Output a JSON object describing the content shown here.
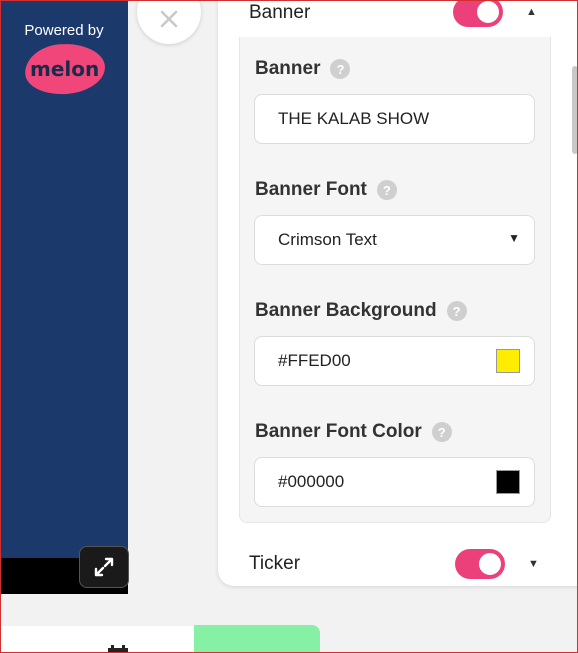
{
  "preview": {
    "powered_by": "Powered by",
    "logo_text": "melon",
    "bg_color": "#1b3a6b",
    "logo_color": "#f0467a"
  },
  "icons": {
    "close": "close-icon",
    "fullscreen": "expand-icon",
    "help": "help-icon",
    "calendar": "calendar-icon"
  },
  "banner_section": {
    "title": "Banner",
    "enabled": true,
    "expanded": true,
    "help_glyph": "?",
    "fields": {
      "banner": {
        "label": "Banner",
        "value": "THE KALAB SHOW"
      },
      "font": {
        "label": "Banner Font",
        "value": "Crimson Text"
      },
      "background": {
        "label": "Banner Background",
        "value": "#FFED00",
        "swatch": "#FFED00"
      },
      "font_color": {
        "label": "Banner Font Color",
        "value": "#000000",
        "swatch": "#000000"
      }
    }
  },
  "ticker_section": {
    "title": "Ticker",
    "enabled": true,
    "expanded": false
  },
  "colors": {
    "toggle_on": "#ec407a",
    "accent_green": "#86f0a4"
  }
}
